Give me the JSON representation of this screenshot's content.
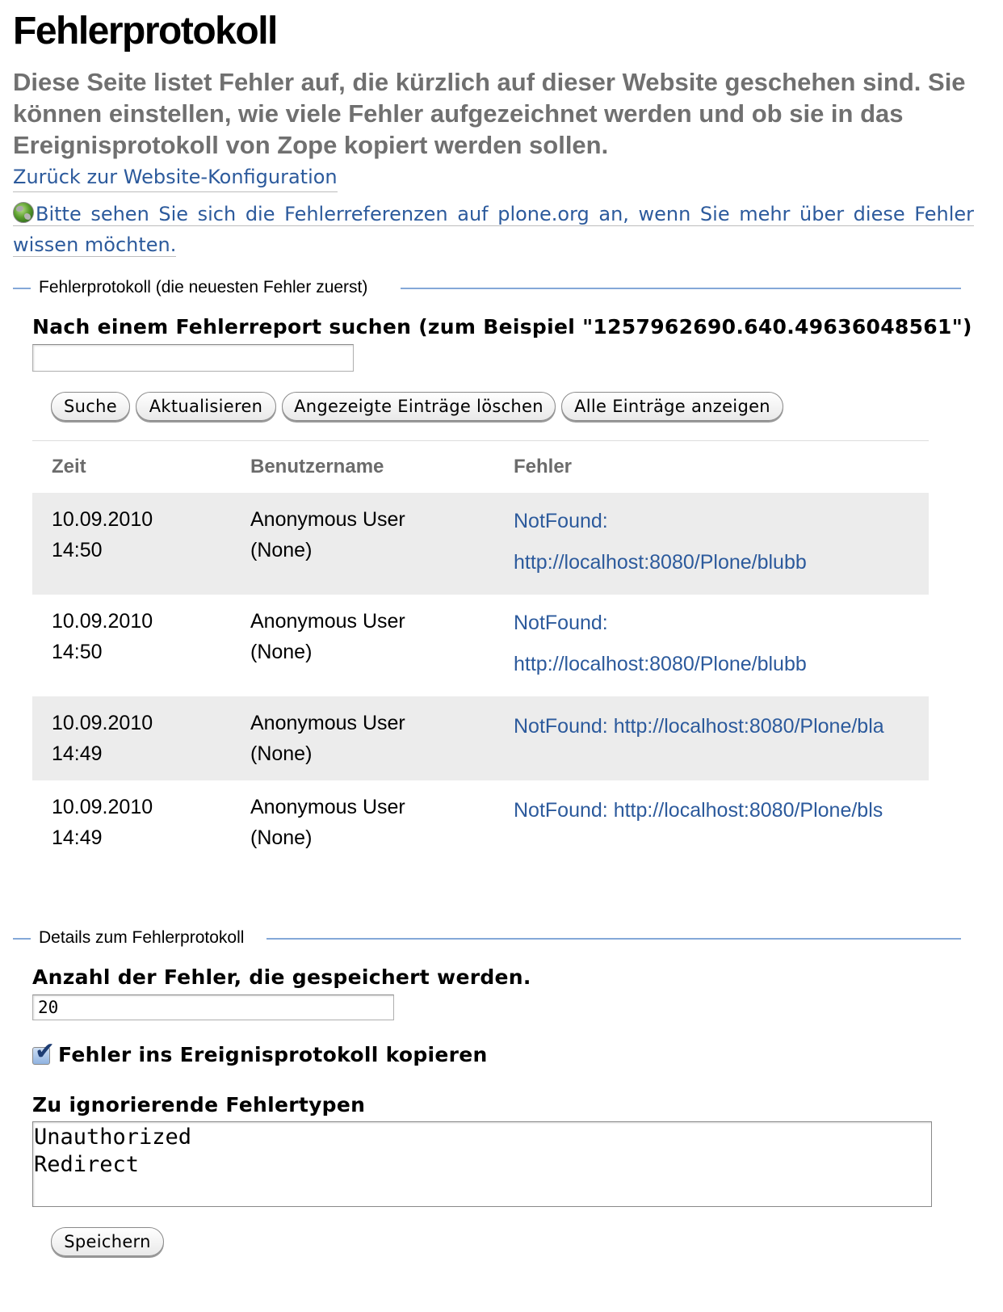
{
  "page": {
    "title": "Fehlerprotokoll",
    "description": "Diese Seite listet Fehler auf, die kürzlich auf dieser Website geschehen sind. Sie können einstellen, wie viele Fehler aufgezeichnet werden und ob sie in das Ereignisprotokoll von Zope kopiert werden sollen.",
    "back_link": "Zurück zur Website-Konfiguration",
    "info_link": "Bitte sehen Sie sich die Fehlerreferenzen auf plone.org an, wenn Sie mehr über diese Fehler wissen möchten."
  },
  "log_section": {
    "legend": "Fehlerprotokoll (die neuesten Fehler zuerst)",
    "search_label": "Nach einem Fehlerreport suchen (zum Beispiel \"1257962690.640.49636048561\")",
    "search_value": "",
    "buttons": {
      "search": "Suche",
      "refresh": "Aktualisieren",
      "delete_shown": "Angezeigte Einträge löschen",
      "show_all": "Alle Einträge anzeigen"
    },
    "columns": [
      "Zeit",
      "Benutzername",
      "Fehler"
    ],
    "rows": [
      {
        "date": "10.09.2010",
        "time": "14:50",
        "user": "Anonymous User",
        "user_id": "(None)",
        "error_type": "NotFound:",
        "error_url": "http://localhost:8080/Plone/blubb"
      },
      {
        "date": "10.09.2010",
        "time": "14:50",
        "user": "Anonymous User",
        "user_id": "(None)",
        "error_type": "NotFound:",
        "error_url": "http://localhost:8080/Plone/blubb"
      },
      {
        "date": "10.09.2010",
        "time": "14:49",
        "user": "Anonymous User",
        "user_id": "(None)",
        "error_type": "NotFound:",
        "error_url": "http://localhost:8080/Plone/bla"
      },
      {
        "date": "10.09.2010",
        "time": "14:49",
        "user": "Anonymous User",
        "user_id": "(None)",
        "error_type": "NotFound:",
        "error_url": "http://localhost:8080/Plone/bls"
      }
    ]
  },
  "details_section": {
    "legend": "Details zum Fehlerprotokoll",
    "keep_label": "Anzahl der Fehler, die gespeichert werden.",
    "keep_value": "20",
    "copy_label": "Fehler ins Ereignisprotokoll kopieren",
    "copy_checked": true,
    "ignore_label": "Zu ignorierende Fehlertypen",
    "ignore_value": "Unauthorized\nRedirect",
    "save_button": "Speichern"
  },
  "colors": {
    "link": "#2c5a9c",
    "legend_line": "#84a8d8",
    "row_stripe": "#ececec",
    "description": "#707070"
  },
  "icons": {
    "info_link_icon": "globe-icon",
    "checkbox": "checkmark-icon"
  }
}
